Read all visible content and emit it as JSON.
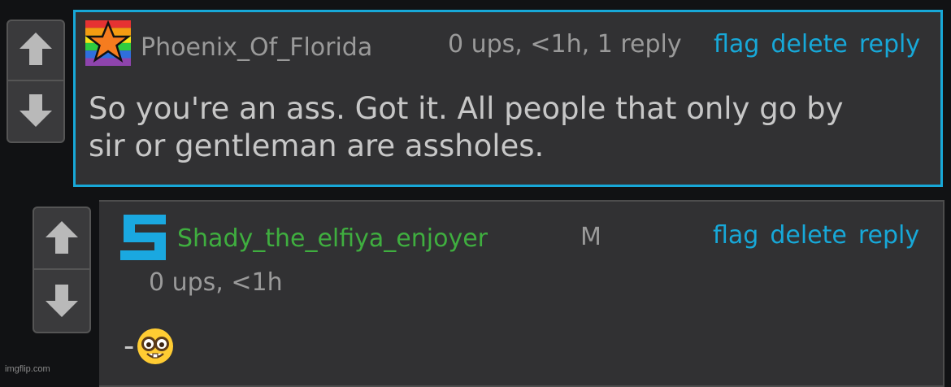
{
  "comments": [
    {
      "username": "Phoenix_Of_Florida",
      "username_color": "#9a9a9a",
      "meta": "0 ups, <1h, 1 reply",
      "actions": {
        "flag": "flag",
        "delete": "delete",
        "reply": "reply"
      },
      "text_line1": "So you're an ass. Got it. All people that only go by",
      "text_line2": "sir or gentleman are assholes.",
      "avatar_icon": "rainbow-star-icon",
      "border_color": "#17a8d8"
    },
    {
      "username": "Shady_the_elfiya_enjoyer",
      "username_color": "#3fae3f",
      "gender_badge": "M",
      "meta": "0 ups, <1h",
      "actions": {
        "flag": "flag",
        "delete": "delete",
        "reply": "reply"
      },
      "text_prefix": "-",
      "text_emoji": "nerd-face-emoji",
      "avatar_icon": "blue-s-logo-icon",
      "accent_color": "#f68b1f"
    }
  ],
  "watermark": "imgflip.com",
  "colors": {
    "link": "#17a8d8",
    "panel": "#313133",
    "background": "#111214"
  }
}
